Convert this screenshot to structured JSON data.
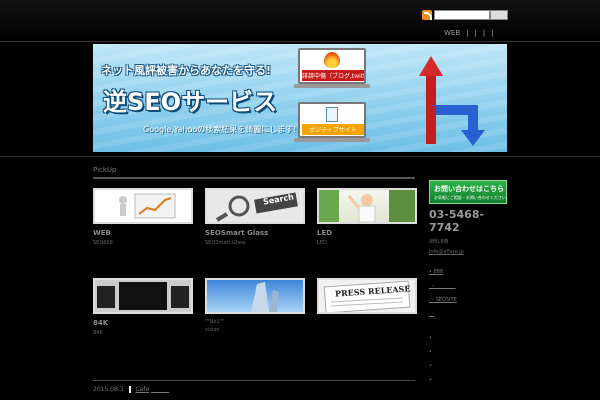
{
  "header": {
    "search_placeholder": "",
    "search_button": "",
    "nav": [
      {
        "label": "WEB"
      },
      {
        "label": "|"
      },
      {
        "label": "|"
      },
      {
        "label": "|"
      },
      {
        "label": "|"
      }
    ]
  },
  "banner": {
    "line1": "ネット風評被害からあなたを守る!",
    "line2": "逆SEOサービス",
    "line3": "Google,Yahooの検索結果を綺麗にします!",
    "laptop1_label": "誹謗中傷（ブログ,twitter,2ch）",
    "laptop2_label": "ポジティブサイト"
  },
  "pickup": {
    "heading": "PickUp",
    "cards": [
      {
        "title": "WEB",
        "sub": "SEO668",
        "sub2": ""
      },
      {
        "title": "SEOSmart Glass",
        "sub": "SEOSmart Glass",
        "sub2": ""
      },
      {
        "title": "LED",
        "sub": "LED",
        "sub2": ""
      },
      {
        "title": "84K",
        "sub": "84K",
        "sub2": ""
      },
      {
        "title": "",
        "sub": "\"\"No1\"\"",
        "sub2": "vision"
      },
      {
        "title": "",
        "sub": "",
        "sub2": ""
      }
    ],
    "thumb_texts": {
      "search": "Search",
      "press": "PRESS RELEASE"
    }
  },
  "sidebar": {
    "contact_title": "お問い合わせはこちら",
    "contact_sub": "お気軽にご相談・お問い合わせください。",
    "phone": "03-5468-7742",
    "hours": "9時18時",
    "email": "info@aflare.jp",
    "links": [
      "888",
      "",
      "SEOSITE",
      ""
    ]
  },
  "footer": {
    "date": "2015.08.3",
    "category": "Cafe"
  },
  "colors": {
    "background": "#000000",
    "contact_green": "#1f9a3b",
    "banner_blue": "#8fd0ee"
  }
}
